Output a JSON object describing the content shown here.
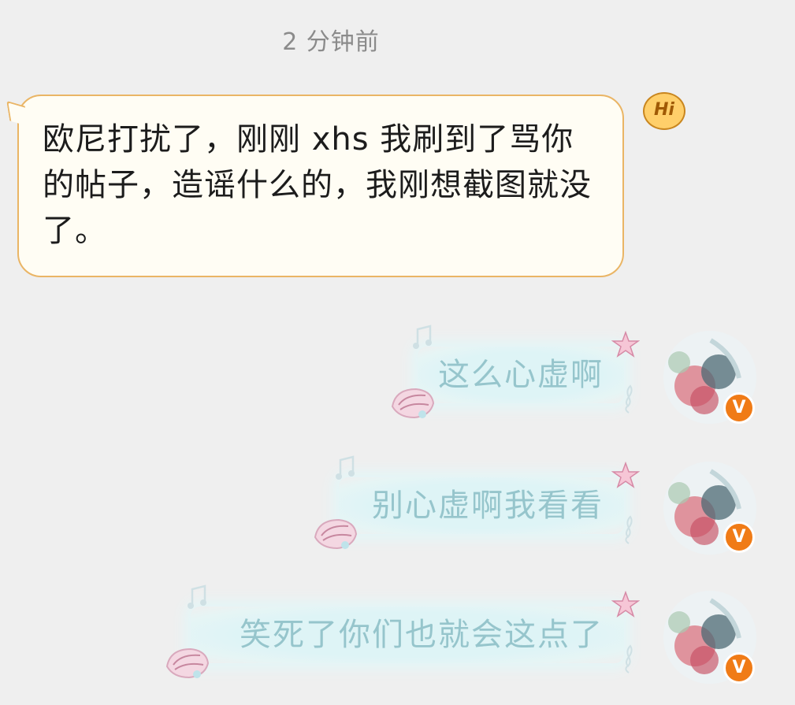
{
  "chat": {
    "timestamp": "2 分钟前",
    "incoming": {
      "text": "欧尼打扰了，刚刚 xhs 我刷到了骂你的帖子，造谣什么的，我刚想截图就没了。",
      "badge": "Hi"
    },
    "outgoing": [
      {
        "text": "这么心虚啊",
        "badge": "V"
      },
      {
        "text": "别心虚啊我看看",
        "badge": "V"
      },
      {
        "text": "笑死了你们也就会这点了",
        "badge": "V"
      }
    ]
  },
  "icons": {
    "incoming_badge": "hi-icon",
    "shell": "seashell-icon",
    "star": "starfish-icon",
    "note": "music-note-icon",
    "clef": "treble-clef-icon",
    "verified": "verified-badge-icon"
  },
  "colors": {
    "background": "#efefef",
    "incoming_bubble": "#fffdf4",
    "incoming_border": "#eab565",
    "outgoing_text": "#96c5cc",
    "verified_badge": "#f07b16"
  }
}
